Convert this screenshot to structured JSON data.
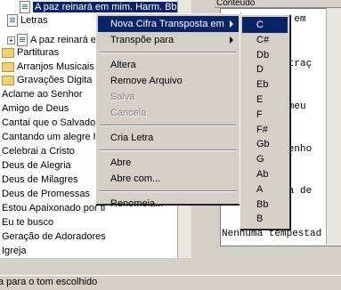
{
  "tree": {
    "items": [
      {
        "label": "A paz reinará em mim. Harm. Bb",
        "kind": "file",
        "indent": 2,
        "selected": true
      },
      {
        "label": "Letras",
        "kind": "file",
        "indent": 1
      },
      {
        "label": "A paz reinará em",
        "kind": "file",
        "indent": 1,
        "expander": "+"
      },
      {
        "label": "Partituras",
        "kind": "folder",
        "indent": 0
      },
      {
        "label": "Arranjos Musicais",
        "kind": "folder",
        "indent": 0
      },
      {
        "label": "Gravações Digita",
        "kind": "folder",
        "indent": 0
      },
      {
        "label": "Aclame ao Senhor",
        "kind": "plain",
        "indent": 0
      },
      {
        "label": "Amigo de Deus",
        "kind": "plain",
        "indent": 0
      },
      {
        "label": "Cantai que o Salvador",
        "kind": "plain",
        "indent": 0
      },
      {
        "label": "Cantando um alegre h",
        "kind": "plain",
        "indent": 0
      },
      {
        "label": "Celebrai a Cristo",
        "kind": "plain",
        "indent": 0
      },
      {
        "label": "Deus de Alegria",
        "kind": "plain",
        "indent": 0
      },
      {
        "label": "Deus de Milagres",
        "kind": "plain",
        "indent": 0
      },
      {
        "label": "Deus de Promessas",
        "kind": "plain",
        "indent": 0
      },
      {
        "label": "Estou Apaixonado por ti",
        "kind": "plain",
        "indent": 0
      },
      {
        "label": "Eu te busco",
        "kind": "plain",
        "indent": 0
      },
      {
        "label": "Geração de Adoradores",
        "kind": "plain",
        "indent": 0
      },
      {
        "label": "Igreja",
        "kind": "plain",
        "indent": 0
      }
    ]
  },
  "content": {
    "header": "Conteudo",
    "lines": [
      "ará em",
      "eu traç",
      "oh meu",
      "e tenho",
      "leta de",
      "Nenhuma tempestad"
    ]
  },
  "context_menu": {
    "items": [
      {
        "label": "Nova Cifra Transposta em",
        "submenu": true,
        "highlighted": true
      },
      {
        "label": "Transpõe para",
        "submenu": true
      },
      {
        "separator": true
      },
      {
        "label": "Altera"
      },
      {
        "label": "Remove Arquivo"
      },
      {
        "label": "Salva",
        "disabled": true
      },
      {
        "label": "Cancela",
        "disabled": true
      },
      {
        "separator": true
      },
      {
        "label": "Cria Letra"
      },
      {
        "separator": true
      },
      {
        "label": "Abre"
      },
      {
        "label": "Abre com..."
      },
      {
        "separator": true
      },
      {
        "label": "Renomeia..."
      }
    ]
  },
  "submenu": {
    "items": [
      "C",
      "C#",
      "Db",
      "D",
      "Eb",
      "E",
      "F",
      "F#",
      "Gb",
      "G",
      "Ab",
      "A",
      "Bb",
      "B"
    ],
    "highlighted_index": 0
  },
  "status": {
    "text": "a para o tom escolhido"
  },
  "colors": {
    "highlight": "#0a246a",
    "face": "#d4d0c8"
  }
}
